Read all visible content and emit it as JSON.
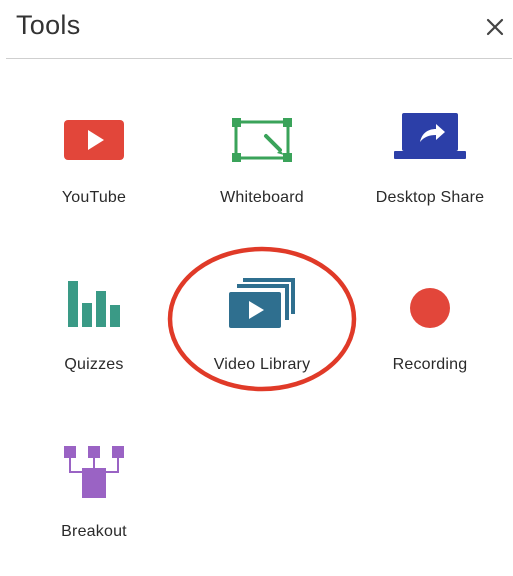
{
  "panel": {
    "title": "Tools",
    "close_icon": "close-icon"
  },
  "tools": [
    {
      "label": "YouTube",
      "icon": "youtube-icon",
      "color": "#e2463a"
    },
    {
      "label": "Whiteboard",
      "icon": "whiteboard-icon",
      "color": "#3aa35a"
    },
    {
      "label": "Desktop Share",
      "icon": "desktop-share-icon",
      "color": "#2c3fa8"
    },
    {
      "label": "Quizzes",
      "icon": "quizzes-icon",
      "color": "#3a9a86"
    },
    {
      "label": "Video Library",
      "icon": "video-library-icon",
      "color": "#2f6f8f"
    },
    {
      "label": "Recording",
      "icon": "recording-icon",
      "color": "#e2463a"
    },
    {
      "label": "Breakout",
      "icon": "breakout-icon",
      "color": "#9a63c4"
    }
  ],
  "annotation_color": "#e03a28"
}
